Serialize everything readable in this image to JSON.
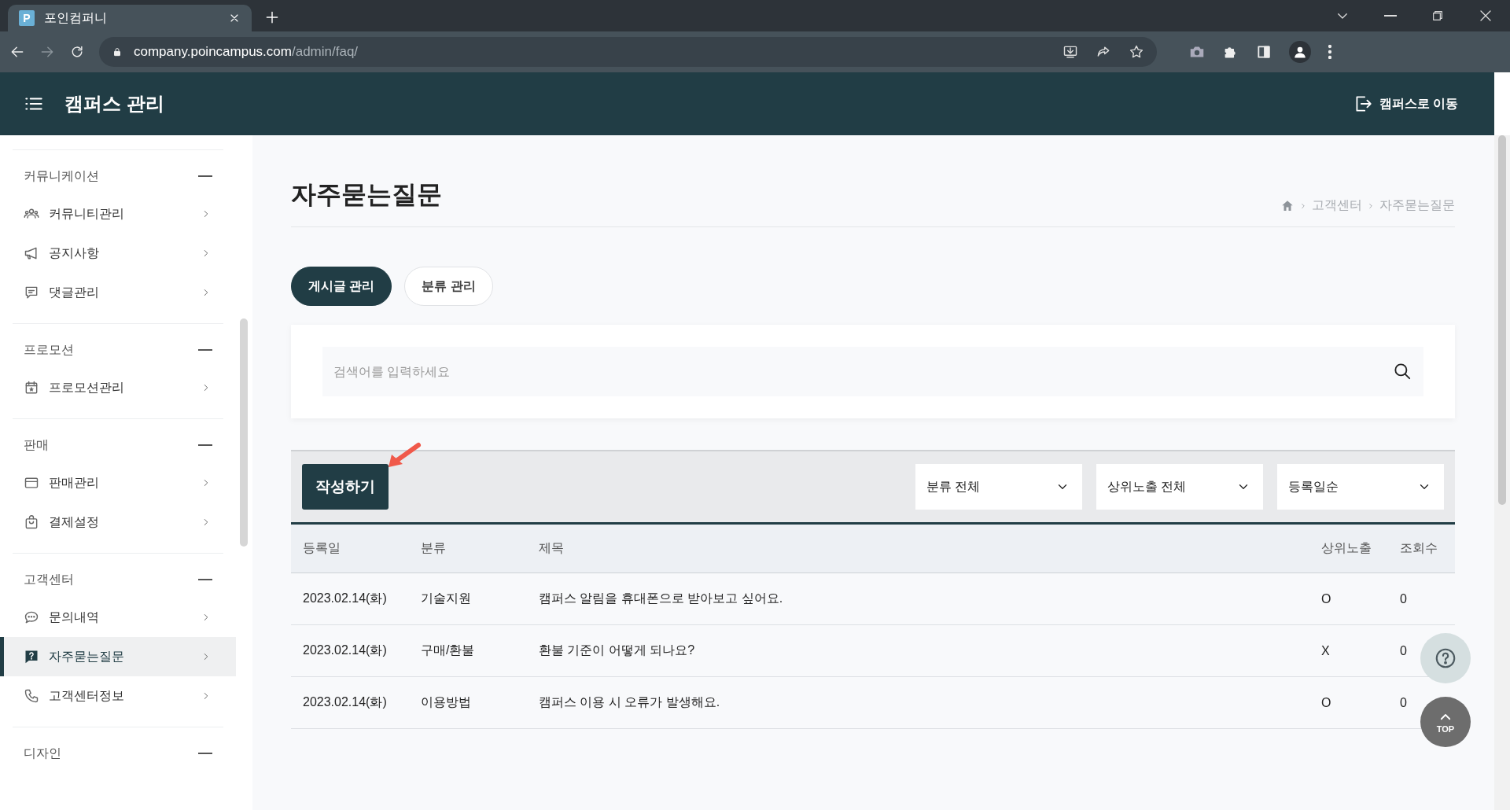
{
  "browser": {
    "tab_favicon": "P",
    "tab_title": "포인컴퍼니",
    "url_host": "company.poincampus.com",
    "url_path": "/admin/faq/"
  },
  "header": {
    "title": "캠퍼스 관리",
    "action": "캠퍼스로 이동"
  },
  "sidebar": {
    "groups": [
      {
        "title": "커뮤니케이션",
        "expanded": true,
        "items": [
          {
            "label": "커뮤니티관리",
            "kind": "people",
            "selected": false
          },
          {
            "label": "공지사항",
            "kind": "megaphone",
            "selected": false
          },
          {
            "label": "댓글관리",
            "kind": "comment",
            "selected": false
          }
        ]
      },
      {
        "title": "프로모션",
        "expanded": true,
        "items": [
          {
            "label": "프로모션관리",
            "kind": "calendar",
            "selected": false
          }
        ]
      },
      {
        "title": "판매",
        "expanded": true,
        "items": [
          {
            "label": "판매관리",
            "kind": "card",
            "selected": false
          },
          {
            "label": "결제설정",
            "kind": "bag",
            "selected": false
          }
        ]
      },
      {
        "title": "고객센터",
        "expanded": true,
        "items": [
          {
            "label": "문의내역",
            "kind": "chat",
            "selected": false
          },
          {
            "label": "자주묻는질문",
            "kind": "question",
            "selected": true
          },
          {
            "label": "고객센터정보",
            "kind": "phone",
            "selected": false
          }
        ]
      },
      {
        "title": "디자인",
        "expanded": true
      }
    ]
  },
  "page": {
    "title": "자주묻는질문",
    "breadcrumb": [
      "고객센터",
      "자주묻는질문"
    ]
  },
  "tabs": [
    {
      "label": "게시글 관리",
      "selected": true
    },
    {
      "label": "분류 관리",
      "selected": false
    }
  ],
  "search": {
    "placeholder": "검색어를 입력하세요"
  },
  "toolbar": {
    "write_button": "작성하기",
    "filters": [
      "분류 전체",
      "상위노출 전체",
      "등록일순"
    ]
  },
  "table": {
    "columns": [
      "등록일",
      "분류",
      "제목",
      "상위노출",
      "조회수"
    ],
    "rows": [
      [
        "2023.02.14(화)",
        "기술지원",
        "캠퍼스 알림을 휴대폰으로 받아보고 싶어요.",
        "O",
        "0"
      ],
      [
        "2023.02.14(화)",
        "구매/환불",
        "환불 기준이 어떻게 되나요?",
        "X",
        "0"
      ],
      [
        "2023.02.14(화)",
        "이용방법",
        "캠퍼스 이용 시 오류가 발생해요.",
        "O",
        "0"
      ]
    ]
  },
  "floating": {
    "top_label": "TOP"
  }
}
